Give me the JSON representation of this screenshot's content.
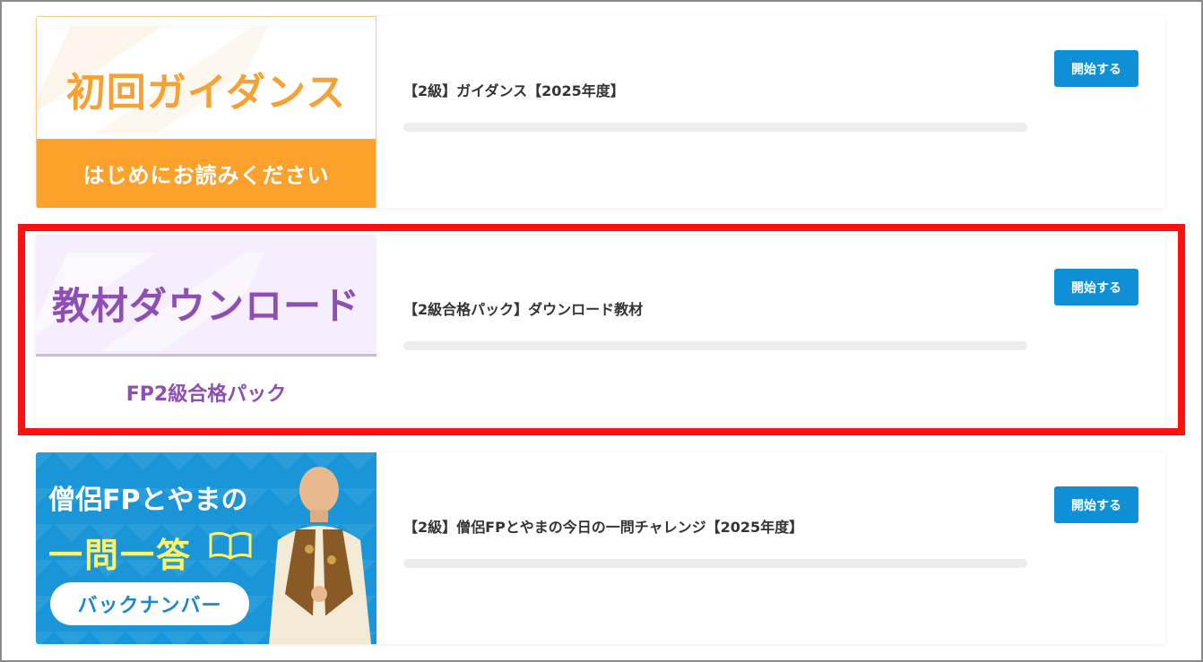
{
  "courses": [
    {
      "thumbnail": {
        "title": "初回ガイダンス",
        "subtitle": "はじめにお読みください",
        "accent": "#fca12b"
      },
      "title": "【2級】ガイダンス【2025年度】",
      "progress": 0,
      "button_label": "開始する"
    },
    {
      "thumbnail": {
        "title": "教材ダウンロード",
        "subtitle": "FP2級合格パック",
        "accent": "#8e4fb5"
      },
      "title": "【2級合格パック】ダウンロード教材",
      "progress": 0,
      "button_label": "開始する",
      "highlighted": true
    },
    {
      "thumbnail": {
        "line1": "僧侶FPとやまの",
        "line2": "一問一答",
        "pill": "バックナンバー",
        "accent": "#1a96d8"
      },
      "title": "【2級】僧侶FPとやまの今日の一問チャレンジ【2025年度】",
      "progress": 0,
      "button_label": "開始する"
    }
  ],
  "colors": {
    "button": "#0f8fd6",
    "highlight_border": "#ff1010",
    "progress_track": "#ececec"
  }
}
